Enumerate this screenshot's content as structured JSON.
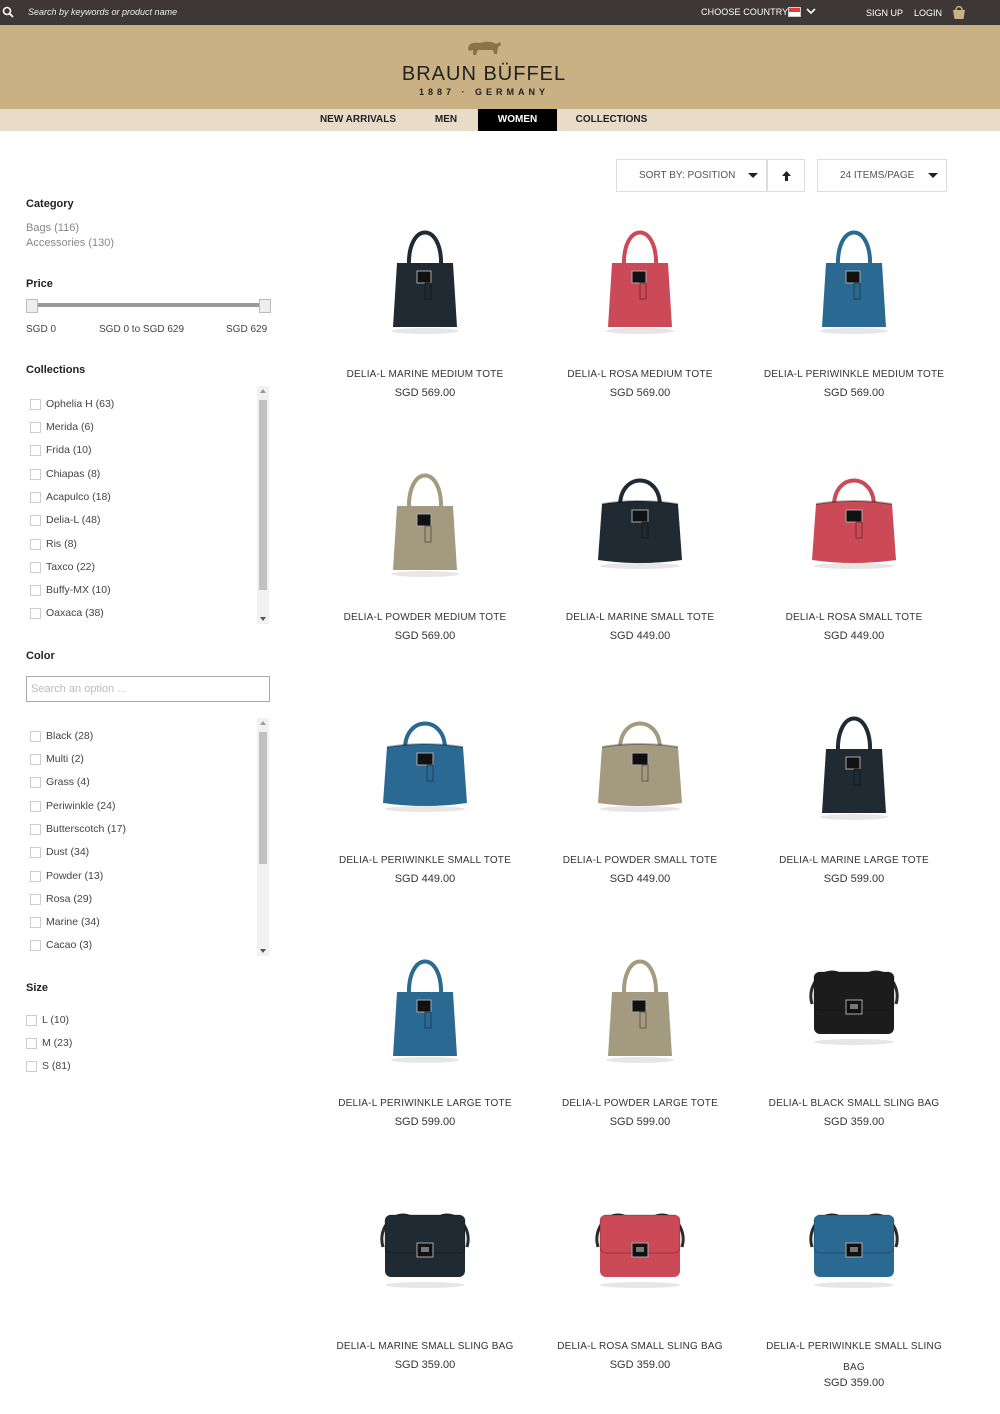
{
  "topbar": {
    "search_placeholder": "Search by keywords or product name",
    "country_label": "CHOOSE COUNTRY:",
    "signup": "SIGN UP",
    "login": "LOGIN"
  },
  "brand": {
    "name": "BRAUN BÜFFEL",
    "subtitle": "1887 · GERMANY"
  },
  "nav": [
    {
      "label": "NEW ARRIVALS",
      "active": false
    },
    {
      "label": "MEN",
      "active": false
    },
    {
      "label": "WOMEN",
      "active": true
    },
    {
      "label": "COLLECTIONS",
      "active": false
    }
  ],
  "toolbar": {
    "sort": "SORT BY: POSITION",
    "per_page": "24 ITEMS/PAGE"
  },
  "filters": {
    "category": {
      "title": "Category",
      "items": [
        "Bags (116)",
        "Accessories (130)"
      ]
    },
    "price": {
      "title": "Price",
      "min": "SGD 0",
      "range": "SGD 0 to SGD 629",
      "max": "SGD 629"
    },
    "collections": {
      "title": "Collections",
      "items": [
        "Ophelia H (63)",
        "Merida (6)",
        "Frida (10)",
        "Chiapas (8)",
        "Acapulco (18)",
        "Delia-L (48)",
        "Ris (8)",
        "Taxco (22)",
        "Buffy-MX (10)",
        "Oaxaca (38)"
      ]
    },
    "color": {
      "title": "Color",
      "search_placeholder": "Search an option ...",
      "items": [
        "Black (28)",
        "Multi (2)",
        "Grass (4)",
        "Periwinkle (24)",
        "Butterscotch (17)",
        "Dust (34)",
        "Powder (13)",
        "Rosa (29)",
        "Marine (34)",
        "Cacao (3)"
      ]
    },
    "size": {
      "title": "Size",
      "items": [
        "L (10)",
        "M (23)",
        "S (81)"
      ]
    }
  },
  "products": [
    {
      "name": "DELIA-L MARINE MEDIUM TOTE",
      "price": "SGD 569.00",
      "style": "tote-tall",
      "color": "#1f2a33"
    },
    {
      "name": "DELIA-L ROSA MEDIUM TOTE",
      "price": "SGD 569.00",
      "style": "tote-tall",
      "color": "#cc4a57"
    },
    {
      "name": "DELIA-L PERIWINKLE MEDIUM TOTE",
      "price": "SGD 569.00",
      "style": "tote-tall",
      "color": "#2a6a92"
    },
    {
      "name": "DELIA-L POWDER MEDIUM TOTE",
      "price": "SGD 569.00",
      "style": "tote-tall",
      "color": "#a49a80"
    },
    {
      "name": "DELIA-L MARINE SMALL TOTE",
      "price": "SGD 449.00",
      "style": "tote-small",
      "color": "#1f2a33"
    },
    {
      "name": "DELIA-L ROSA SMALL TOTE",
      "price": "SGD 449.00",
      "style": "tote-small",
      "color": "#cc4a57"
    },
    {
      "name": "DELIA-L PERIWINKLE SMALL TOTE",
      "price": "SGD 449.00",
      "style": "tote-small",
      "color": "#2a6a92"
    },
    {
      "name": "DELIA-L POWDER SMALL TOTE",
      "price": "SGD 449.00",
      "style": "tote-small",
      "color": "#a49a80"
    },
    {
      "name": "DELIA-L MARINE LARGE TOTE",
      "price": "SGD 599.00",
      "style": "tote-tall",
      "color": "#1f2a33"
    },
    {
      "name": "DELIA-L PERIWINKLE LARGE TOTE",
      "price": "SGD 599.00",
      "style": "tote-tall",
      "color": "#2a6a92"
    },
    {
      "name": "DELIA-L POWDER LARGE TOTE",
      "price": "SGD 599.00",
      "style": "tote-tall",
      "color": "#a49a80"
    },
    {
      "name": "DELIA-L BLACK SMALL SLING BAG",
      "price": "SGD 359.00",
      "style": "sling",
      "color": "#1c1c1c"
    },
    {
      "name": "DELIA-L MARINE SMALL SLING BAG",
      "price": "SGD 359.00",
      "style": "sling",
      "color": "#1f2a33"
    },
    {
      "name": "DELIA-L ROSA SMALL SLING BAG",
      "price": "SGD 359.00",
      "style": "sling",
      "color": "#cc4a57"
    },
    {
      "name": "DELIA-L PERIWINKLE SMALL SLING BAG",
      "price": "SGD 359.00",
      "style": "sling",
      "color": "#2a6a92"
    }
  ],
  "colors": {
    "topbar": "#3d3835",
    "header": "#c9b184",
    "nav": "#e8dcc9"
  }
}
